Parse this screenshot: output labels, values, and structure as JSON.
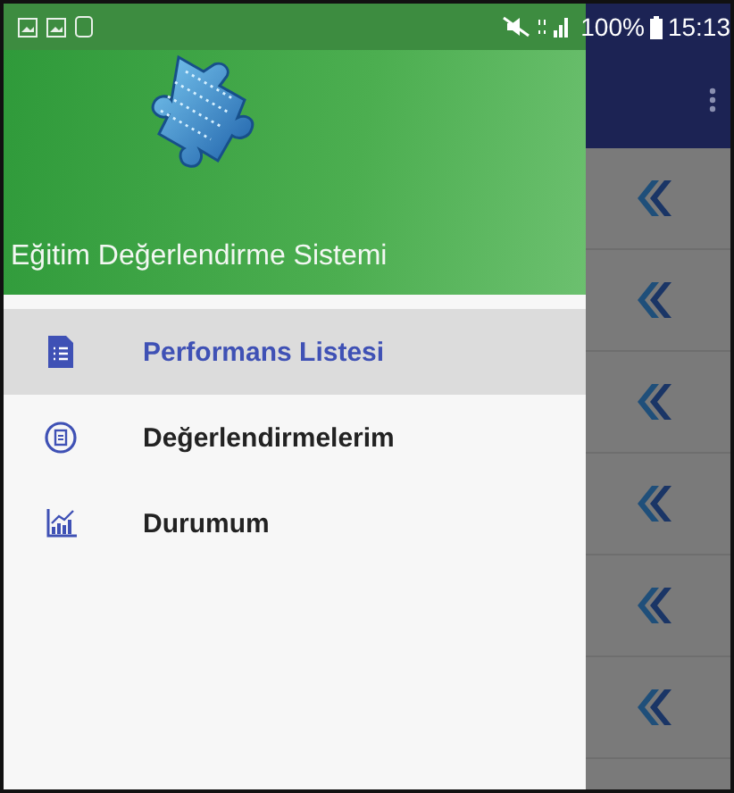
{
  "status_bar": {
    "battery": "100%",
    "time": "15:13"
  },
  "drawer": {
    "title": "Eğitim Değerlendirme Sistemi",
    "items": [
      {
        "label": "Performans Listesi",
        "selected": true,
        "kind": "document"
      },
      {
        "label": "Değerlendirmelerim",
        "selected": false,
        "kind": "review"
      },
      {
        "label": "Durumum",
        "selected": false,
        "kind": "chart"
      }
    ]
  },
  "list": {
    "rows": [
      {
        "kind": "collapse"
      },
      {
        "kind": "collapse"
      },
      {
        "kind": "collapse"
      },
      {
        "kind": "collapse"
      },
      {
        "kind": "collapse"
      },
      {
        "kind": "collapse"
      }
    ]
  }
}
